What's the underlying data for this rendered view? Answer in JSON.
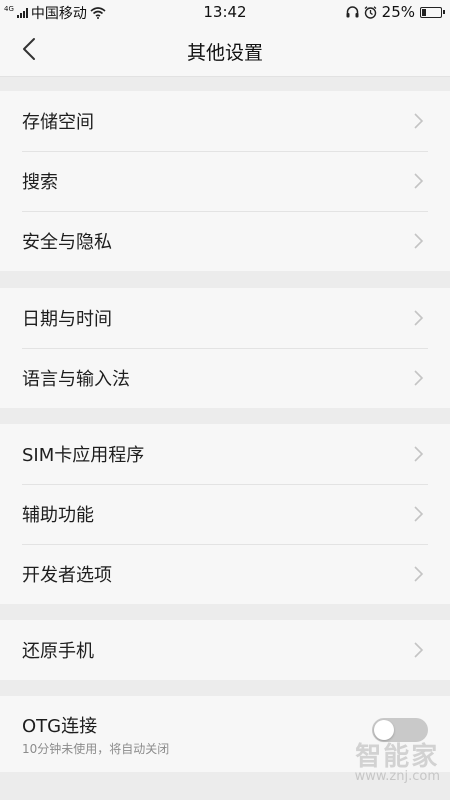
{
  "status_bar": {
    "signal_label": "4G",
    "carrier": "中国移动",
    "time": "13:42",
    "battery_percent": "25%",
    "battery_level": 0.25,
    "icons": [
      "signal-icon",
      "wifi-icon",
      "headphones-icon",
      "alarm-icon",
      "battery-icon"
    ]
  },
  "nav": {
    "title": "其他设置",
    "back_icon": "chevron-left-icon"
  },
  "groups": [
    {
      "items": [
        "存储空间",
        "搜索",
        "安全与隐私"
      ]
    },
    {
      "items": [
        "日期与时间",
        "语言与输入法"
      ]
    },
    {
      "items": [
        "SIM卡应用程序",
        "辅助功能",
        "开发者选项"
      ]
    },
    {
      "items": [
        "还原手机"
      ]
    }
  ],
  "otg": {
    "title": "OTG连接",
    "subtitle": "10分钟未使用，将自动关闭",
    "enabled": false
  },
  "watermark": {
    "logo": "智能家",
    "url": "www.znj.com"
  },
  "colors": {
    "background": "#ececec",
    "card": "#f7f7f7",
    "divider": "#e3e3e3",
    "chevron": "#c4c4c4",
    "toggle_off": "#c9c9c9"
  }
}
